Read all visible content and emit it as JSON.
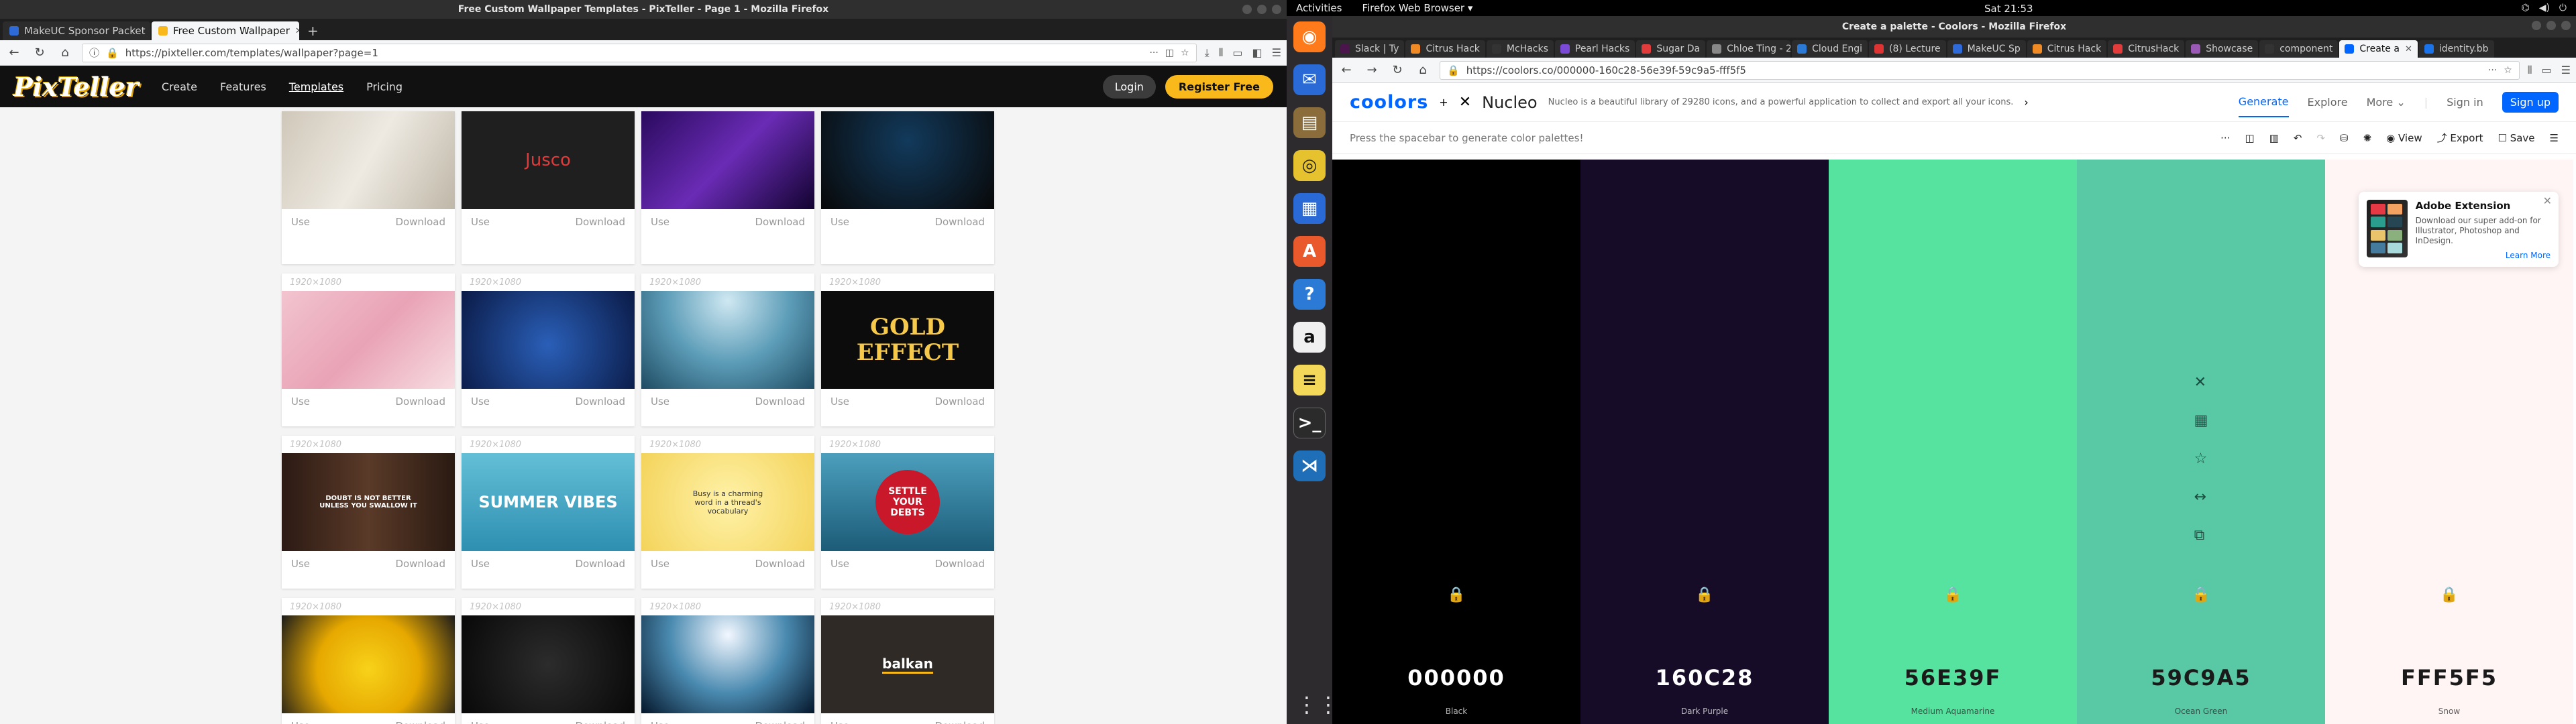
{
  "left": {
    "window_title": "Free Custom Wallpaper Templates - PixTeller - Page 1 - Mozilla Firefox",
    "tabs": [
      {
        "label": "MakeUC Sponsor Packet",
        "active": false,
        "color": "#2e6bd9"
      },
      {
        "label": "Free Custom Wallpaper",
        "active": true,
        "color": "#f9b91a"
      }
    ],
    "new_tab": "+",
    "url": "https://pixteller.com/templates/wallpaper?page=1",
    "nav": {
      "logo": "PixTeller",
      "items": [
        "Create",
        "Features",
        "Templates",
        "Pricing"
      ],
      "login": "Login",
      "register": "Register Free"
    },
    "cards": [
      {
        "size": "",
        "use": "Use",
        "download": "Download",
        "bg": "linear-gradient(120deg,#cfc7b9,#eeeae2,#bfb7a8)",
        "text": ""
      },
      {
        "size": "",
        "use": "Use",
        "download": "Download",
        "bg": "#1f1f1f",
        "text": "Jusco"
      },
      {
        "size": "",
        "use": "Use",
        "download": "Download",
        "bg": "linear-gradient(135deg,#2a0a5e,#6a2bb5,#120330)",
        "text": ""
      },
      {
        "size": "",
        "use": "Use",
        "download": "Download",
        "bg": "radial-gradient(circle at 50% 30%,#123a5c,#080808)",
        "text": ""
      },
      {
        "size": "1920×1080",
        "use": "Use",
        "download": "Download",
        "bg": "linear-gradient(135deg,#f2c4cf,#e9a3b6,#f7dde2)",
        "text": ""
      },
      {
        "size": "1920×1080",
        "use": "Use",
        "download": "Download",
        "bg": "radial-gradient(circle at 50% 55%,#2a5fb8,#0a1a46)",
        "text": ""
      },
      {
        "size": "1920×1080",
        "use": "Use",
        "download": "Download",
        "bg": "radial-gradient(circle at 50% 10%,#cfe8f2,#5d9db8,#1f4c63)",
        "text": ""
      },
      {
        "size": "1920×1080",
        "use": "Use",
        "download": "Download",
        "bg": "#0c0c0c",
        "text": "GOLD EFFECT"
      },
      {
        "size": "1920×1080",
        "use": "Use",
        "download": "Download",
        "bg": "linear-gradient(90deg,#2c1a14,#5a3a28,#2a1a12)",
        "text": "DOUBT IS NOT BETTER UNLESS YOU SWALLOW IT"
      },
      {
        "size": "1920×1080",
        "use": "Use",
        "download": "Download",
        "bg": "linear-gradient(180deg,#63bfd6,#2e8fb1)",
        "text": "SUMMER VIBES"
      },
      {
        "size": "1920×1080",
        "use": "Use",
        "download": "Download",
        "bg": "radial-gradient(circle,#fff2a8,#f3d35a)",
        "text": "Busy is a charming word in a thread's vocabulary"
      },
      {
        "size": "1920×1080",
        "use": "Use",
        "download": "Download",
        "bg": "linear-gradient(180deg,#4b9fbd,#1c5c78)",
        "text": "SETTLE YOUR DEBTS"
      },
      {
        "size": "1920×1080",
        "use": "Use",
        "download": "Download",
        "bg": "radial-gradient(circle at 50% 55%,#f8d21a,#e6a800,#1a1a1a)",
        "text": ""
      },
      {
        "size": "1920×1080",
        "use": "Use",
        "download": "Download",
        "bg": "radial-gradient(circle,#2c2c2c,#080808)",
        "text": ""
      },
      {
        "size": "1920×1080",
        "use": "Use",
        "download": "Download",
        "bg": "radial-gradient(circle at 50% 20%,#f2f7ff,#4a8ab0,#04162a)",
        "text": ""
      },
      {
        "size": "1920×1080",
        "use": "Use",
        "download": "Download",
        "bg": "#2f2a26",
        "text": "balkan"
      }
    ]
  },
  "right": {
    "gnome": {
      "activities": "Activities",
      "app": "Firefox Web Browser",
      "clock": "Sat 21:53"
    },
    "window_title": "Create a palette - Coolors - Mozilla Firefox",
    "tabs": [
      "Slack | Ty",
      "Citrus Hack",
      "McHacks",
      "Pearl Hacks",
      "Sugar Da",
      "Chloe Ting - 2",
      "Cloud Engi",
      "(8) Lecture",
      "MakeUC Sp",
      "Citrus Hack",
      "CitrusHack",
      "Showcase",
      "component",
      "Create a",
      "identity.bb"
    ],
    "url": "https://coolors.co/000000-160c28-56e39f-59c9a5-fff5f5",
    "header": {
      "logo": "coolors",
      "plus": "+",
      "nucleo": "Nucleo",
      "tagline": "Nucleo is a beautiful library of 29280 icons, and a powerful application to collect and export all your icons.",
      "links": [
        "Generate",
        "Explore",
        "More"
      ],
      "signin": "Sign in",
      "signup": "Sign up"
    },
    "toolbar": {
      "hint": "Press the spacebar to generate color palettes!",
      "view": "View",
      "export": "Export",
      "save": "Save"
    },
    "palette": [
      {
        "hex": "000000",
        "name": "Black",
        "color": "#000000",
        "text": "#ffffff"
      },
      {
        "hex": "160C28",
        "name": "Dark Purple",
        "color": "#160c28",
        "text": "#ffffff"
      },
      {
        "hex": "56E39F",
        "name": "Medium Aquamarine",
        "color": "#56e39f",
        "text": "#1a1a1a"
      },
      {
        "hex": "59C9A5",
        "name": "Ocean Green",
        "color": "#59c9a5",
        "text": "#1a1a1a"
      },
      {
        "hex": "FFF5F5",
        "name": "Snow",
        "color": "#fff5f5",
        "text": "#1a1a1a"
      }
    ],
    "extension": {
      "title": "Adobe Extension",
      "desc": "Download our super add-on for Illustrator, Photoshop and InDesign.",
      "more": "Learn More"
    }
  }
}
